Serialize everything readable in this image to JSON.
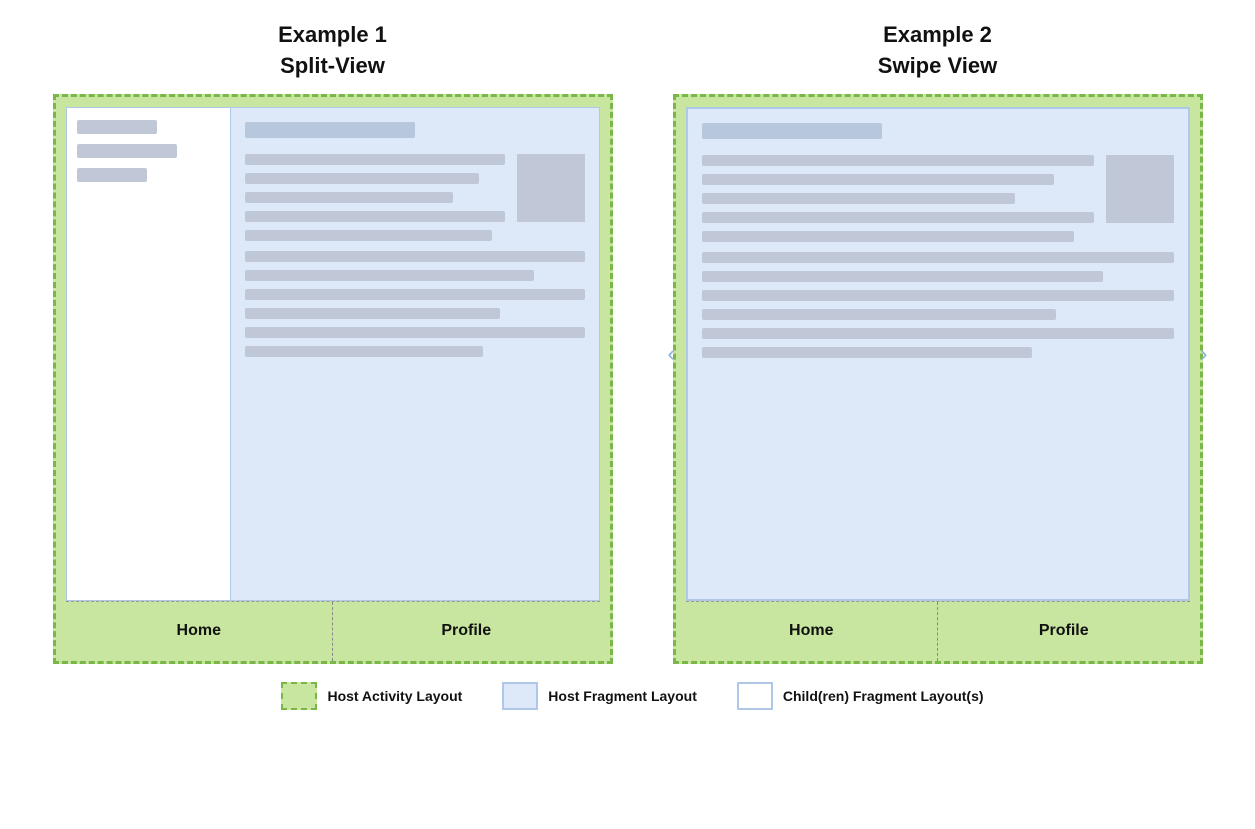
{
  "examples": [
    {
      "id": "example1",
      "title_line1": "Example 1",
      "title_line2": "Split-View",
      "nav_items": [
        "Home",
        "Profile"
      ]
    },
    {
      "id": "example2",
      "title_line1": "Example 2",
      "title_line2": "Swipe View",
      "nav_items": [
        "Home",
        "Profile"
      ]
    }
  ],
  "legend": [
    {
      "type": "green",
      "label": "Host Activity Layout"
    },
    {
      "type": "blue",
      "label": "Host Fragment Layout"
    },
    {
      "type": "white",
      "label": "Child(ren) Fragment Layout(s)"
    }
  ],
  "arrows": {
    "left": "‹",
    "right": "›"
  }
}
